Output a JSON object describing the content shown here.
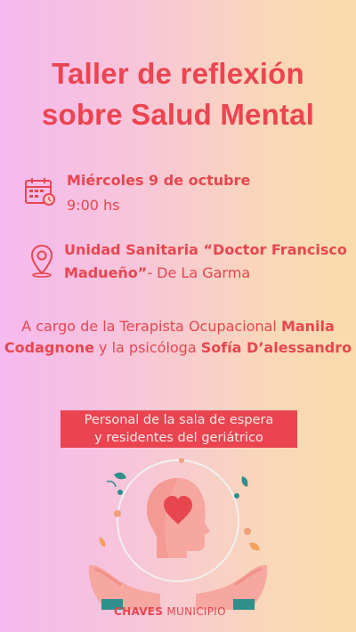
{
  "poster": {
    "title_line1": "Taller de reflexión",
    "title_line2": "sobre Salud Mental",
    "date": "Miércoles 9 de octubre",
    "time": "9:00 hs",
    "place_bold": "Unidad Sanitaria “Doctor Francisco Madueño”",
    "place_rest": "- De La Garma",
    "desc_prefix": "A cargo de la Terapista Ocupacional ",
    "desc_name1": "Manila Codagnone",
    "desc_mid": " y la psicóloga ",
    "desc_name2": "Sofía D’alessandro",
    "banner_line1": "Personal de la sala de espera",
    "banner_line2": "y residentes del geriátrico",
    "footer_bold": "CHAVES",
    "footer_rest": " MUNICIPIO"
  },
  "icons": {
    "calendar": "calendar-icon",
    "location": "location-pin-icon",
    "illustration": "hands-head-heart-illustration"
  },
  "colors": {
    "accent": "#ec4450",
    "banner_bg": "#ea4451",
    "banner_text": "#fde7e3",
    "bg_left": "#f6b9ef",
    "bg_right": "#f9dcab"
  }
}
